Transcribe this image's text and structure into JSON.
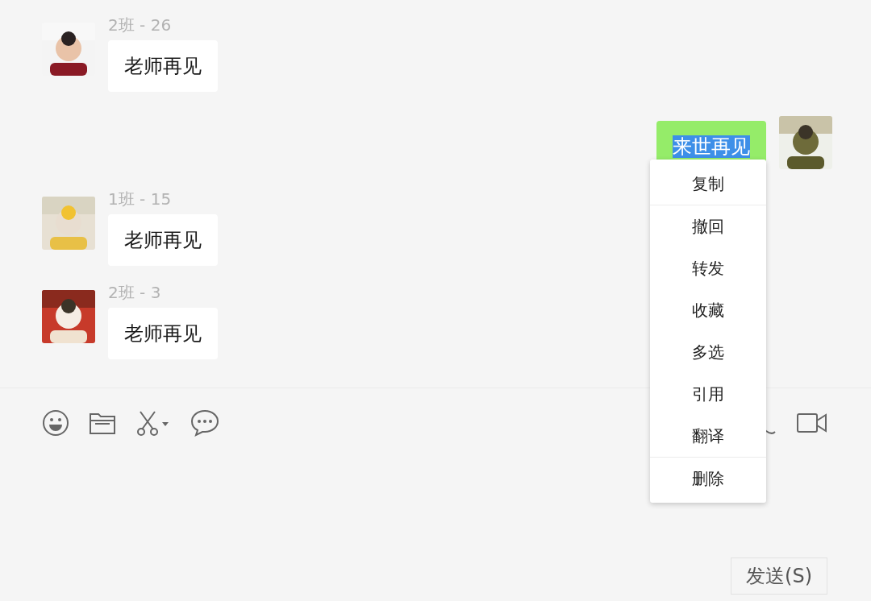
{
  "messages": [
    {
      "kind": "incoming",
      "sender": "2班 - 26",
      "text": "老师再见"
    },
    {
      "kind": "outgoing",
      "text": "来世再见",
      "text_selected": true
    },
    {
      "kind": "incoming",
      "sender": "1班 - 15",
      "text": "老师再见"
    },
    {
      "kind": "incoming",
      "sender": "2班 - 3",
      "text": "老师再见"
    }
  ],
  "context_menu": {
    "groups": [
      [
        "复制"
      ],
      [
        "撤回",
        "转发",
        "收藏",
        "多选",
        "引用",
        "翻译"
      ],
      [
        "删除"
      ]
    ]
  },
  "send_button": "发送(S)"
}
